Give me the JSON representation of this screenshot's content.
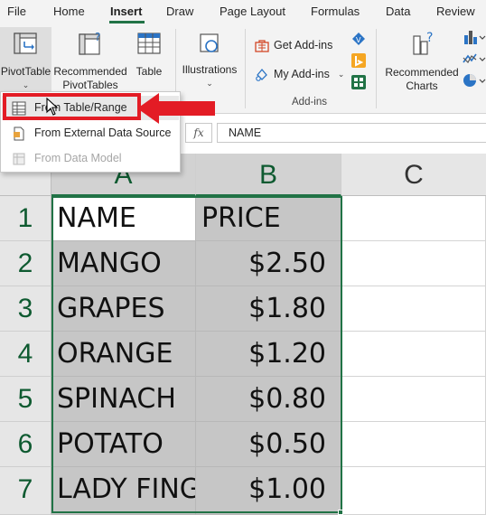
{
  "ribbon_tabs": [
    "File",
    "Home",
    "Insert",
    "Draw",
    "Page Layout",
    "Formulas",
    "Data",
    "Review"
  ],
  "active_tab": "Insert",
  "ribbon": {
    "pivot_table": "PivotTable",
    "recommended_pivottables_line1": "Recommended",
    "recommended_pivottables_line2": "PivotTables",
    "table": "Table",
    "illustrations": "Illustrations",
    "get_addins": "Get Add-ins",
    "my_addins": "My Add-ins",
    "addins_group": "Add-ins",
    "recommended_charts_line1": "Recommended",
    "recommended_charts_line2": "Charts"
  },
  "formula_bar": {
    "fx": "fx",
    "value": "NAME"
  },
  "dropdown": {
    "items": [
      {
        "label": "From Table/Range",
        "state": "hover"
      },
      {
        "label": "From External Data Source",
        "state": "enabled"
      },
      {
        "label": "From Data Model",
        "state": "disabled"
      }
    ]
  },
  "columns": [
    "A",
    "B",
    "C"
  ],
  "rows": [
    "1",
    "2",
    "3",
    "4",
    "5",
    "6",
    "7"
  ],
  "sheet": {
    "header": {
      "name": "NAME",
      "price": "PRICE"
    },
    "data": [
      {
        "name": "MANGO",
        "price": "$2.50"
      },
      {
        "name": "GRAPES",
        "price": "$1.80"
      },
      {
        "name": "ORANGE",
        "price": "$1.20"
      },
      {
        "name": "SPINACH",
        "price": "$0.80"
      },
      {
        "name": "POTATO",
        "price": "$0.50"
      },
      {
        "name": "LADY FINGER",
        "price": "$1.00"
      }
    ]
  },
  "colors": {
    "accent": "#217346",
    "highlight_red": "#e31c25",
    "selection_fill": "#c6c6c6"
  }
}
